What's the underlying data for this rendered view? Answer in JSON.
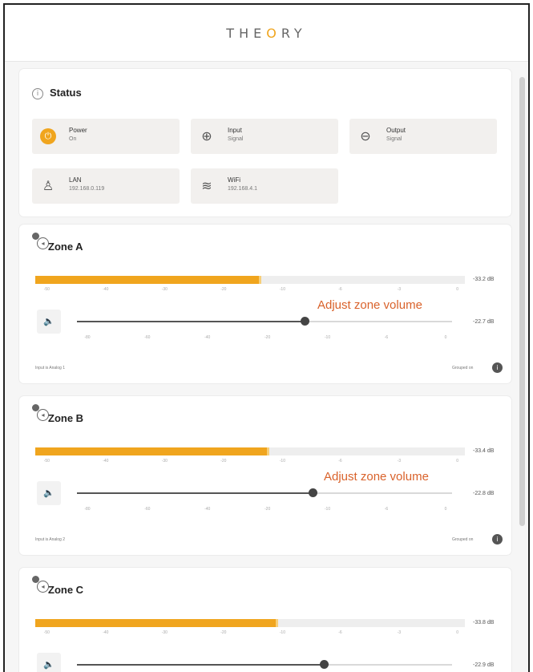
{
  "header": {
    "logo_text": "THEORY",
    "logo_tagline": ""
  },
  "status": {
    "title": "Status",
    "tiles": [
      {
        "icon": "power-icon",
        "label": "Power",
        "value": "On"
      },
      {
        "icon": "input-icon",
        "label": "Input",
        "value": "Signal"
      },
      {
        "icon": "output-icon",
        "label": "Output",
        "value": "Signal"
      },
      {
        "icon": "lan-icon",
        "label": "LAN",
        "value": "192.168.0.119"
      },
      {
        "icon": "wifi-icon",
        "label": "WiFi",
        "value": "192.168.4.1"
      }
    ]
  },
  "zones": [
    {
      "title": "Zone A",
      "meter_level": 0.52,
      "meter_value": "-33.2 dB",
      "slider_level": 0.61,
      "volume_value": "-22.7 dB",
      "annotation": "Adjust zone volume",
      "footer_left": "Input is Analog 1",
      "footer_right": "Grouped on",
      "meter_ticks": [
        "-50",
        "-40",
        "-30",
        "-20",
        "-10",
        "-6",
        "-3",
        "0"
      ],
      "slider_ticks": [
        "-80",
        "-60",
        "-40",
        "-20",
        "-10",
        "-6",
        "0"
      ]
    },
    {
      "title": "Zone B",
      "meter_level": 0.54,
      "meter_value": "-33.4 dB",
      "slider_level": 0.63,
      "volume_value": "-22.8 dB",
      "annotation": "Adjust zone volume",
      "footer_left": "Input is Analog 2",
      "footer_right": "Grouped on",
      "meter_ticks": [
        "-50",
        "-40",
        "-30",
        "-20",
        "-10",
        "-6",
        "-3",
        "0"
      ],
      "slider_ticks": [
        "-80",
        "-60",
        "-40",
        "-20",
        "-10",
        "-6",
        "0"
      ]
    },
    {
      "title": "Zone C",
      "meter_level": 0.56,
      "meter_value": "-33.8 dB",
      "slider_level": 0.66,
      "volume_value": "-22.9 dB",
      "annotation": "",
      "footer_left": "",
      "footer_right": "",
      "meter_ticks": [
        "-50",
        "-40",
        "-30",
        "-20",
        "-10",
        "-6",
        "-3",
        "0"
      ],
      "slider_ticks": []
    }
  ],
  "colors": {
    "accent": "#f0a51e",
    "annotation": "#d9622b"
  }
}
